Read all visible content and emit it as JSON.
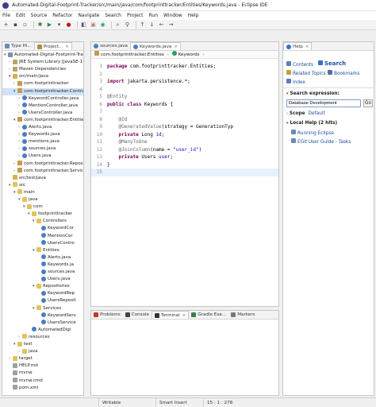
{
  "window": {
    "title": "Automated-Digital-Footprint-Tracker/src/main/java/com/footprinttracker/Entities/Keywords.java - Eclipse IDE"
  },
  "menu": [
    "File",
    "Edit",
    "Source",
    "Refactor",
    "Navigate",
    "Search",
    "Project",
    "Run",
    "Window",
    "Help"
  ],
  "left_panel": {
    "tabs": [
      {
        "label": "Type Hi..."
      },
      {
        "label": "Project..."
      }
    ],
    "tree": [
      {
        "depth": 0,
        "arrow": "▾",
        "icon": "proj",
        "label": "Automated-Digital-Footprint-Tracker"
      },
      {
        "depth": 1,
        "arrow": "›",
        "icon": "lib",
        "label": "JRE System Library [JavaSE-17]"
      },
      {
        "depth": 1,
        "arrow": "›",
        "icon": "lib",
        "label": "Maven Dependencies"
      },
      {
        "depth": 1,
        "arrow": "▾",
        "icon": "srcf",
        "label": "src/main/java"
      },
      {
        "depth": 2,
        "arrow": "›",
        "icon": "pkg",
        "label": "com.footprinttracker"
      },
      {
        "depth": 2,
        "arrow": "▾",
        "icon": "pkg",
        "label": "com.footprinttracker.Controllers",
        "selected": true
      },
      {
        "depth": 3,
        "arrow": "›",
        "icon": "java",
        "label": "KeywordController.java"
      },
      {
        "depth": 3,
        "arrow": "›",
        "icon": "java",
        "label": "MentionController.java"
      },
      {
        "depth": 3,
        "arrow": "›",
        "icon": "java",
        "label": "UsersController.java"
      },
      {
        "depth": 2,
        "arrow": "▾",
        "icon": "pkg",
        "label": "com.footprinttracker.Entities"
      },
      {
        "depth": 3,
        "arrow": "›",
        "icon": "java",
        "label": "Alerts.java"
      },
      {
        "depth": 3,
        "arrow": "›",
        "icon": "java",
        "label": "Keywords.java"
      },
      {
        "depth": 3,
        "arrow": "›",
        "icon": "java",
        "label": "mentions.java"
      },
      {
        "depth": 3,
        "arrow": "›",
        "icon": "java",
        "label": "sources.java"
      },
      {
        "depth": 3,
        "arrow": "›",
        "icon": "java",
        "label": "Users.java"
      },
      {
        "depth": 2,
        "arrow": "›",
        "icon": "pkg",
        "label": "com.footprinttracker.Repos"
      },
      {
        "depth": 2,
        "arrow": "›",
        "icon": "pkg",
        "label": "com.footprinttracker.Servic"
      },
      {
        "depth": 1,
        "arrow": "",
        "icon": "srcf",
        "label": "src/test/java"
      },
      {
        "depth": 1,
        "arrow": "▾",
        "icon": "folder",
        "label": "src"
      },
      {
        "depth": 2,
        "arrow": "▾",
        "icon": "folder",
        "label": "main"
      },
      {
        "depth": 3,
        "arrow": "▾",
        "icon": "folder",
        "label": "java"
      },
      {
        "depth": 4,
        "arrow": "▾",
        "icon": "folder",
        "label": "com"
      },
      {
        "depth": 5,
        "arrow": "▾",
        "icon": "folder",
        "label": "footprinttracker"
      },
      {
        "depth": 6,
        "arrow": "▾",
        "icon": "folder",
        "label": "Controllers"
      },
      {
        "depth": 7,
        "arrow": "",
        "icon": "java",
        "label": "KeywordCor"
      },
      {
        "depth": 7,
        "arrow": "",
        "icon": "java",
        "label": "MentionCor"
      },
      {
        "depth": 7,
        "arrow": "",
        "icon": "java",
        "label": "UsersContro"
      },
      {
        "depth": 6,
        "arrow": "▾",
        "icon": "folder",
        "label": "Entities"
      },
      {
        "depth": 7,
        "arrow": "",
        "icon": "java",
        "label": "Alerts.java"
      },
      {
        "depth": 7,
        "arrow": "",
        "icon": "java",
        "label": "Keywords.ja"
      },
      {
        "depth": 7,
        "arrow": "",
        "icon": "java",
        "label": "sources.java"
      },
      {
        "depth": 7,
        "arrow": "",
        "icon": "java",
        "label": "Users.java"
      },
      {
        "depth": 6,
        "arrow": "▾",
        "icon": "folder",
        "label": "Repositories"
      },
      {
        "depth": 7,
        "arrow": "",
        "icon": "java",
        "label": "KeywordRep"
      },
      {
        "depth": 7,
        "arrow": "",
        "icon": "java",
        "label": "UsersReposit"
      },
      {
        "depth": 6,
        "arrow": "▾",
        "icon": "folder",
        "label": "Services"
      },
      {
        "depth": 7,
        "arrow": "",
        "icon": "java",
        "label": "KeywordServ"
      },
      {
        "depth": 7,
        "arrow": "",
        "icon": "java",
        "label": "UsersService"
      },
      {
        "depth": 5,
        "arrow": "",
        "icon": "java",
        "label": "AutomatedDigi"
      },
      {
        "depth": 3,
        "arrow": "›",
        "icon": "folder",
        "label": "resources"
      },
      {
        "depth": 2,
        "arrow": "▾",
        "icon": "folder",
        "label": "test"
      },
      {
        "depth": 3,
        "arrow": "›",
        "icon": "folder",
        "label": "java"
      },
      {
        "depth": 1,
        "arrow": "›",
        "icon": "folder",
        "label": "target"
      },
      {
        "depth": 1,
        "arrow": "",
        "icon": "file",
        "label": "HELP.md"
      },
      {
        "depth": 1,
        "arrow": "",
        "icon": "file",
        "label": "mvnw"
      },
      {
        "depth": 1,
        "arrow": "",
        "icon": "file",
        "label": "mvnw.cmd"
      },
      {
        "depth": 1,
        "arrow": "",
        "icon": "file",
        "label": "pom.xml"
      }
    ]
  },
  "editor": {
    "tabs": [
      {
        "label": "sources.java",
        "active": false
      },
      {
        "label": "Keywords.java",
        "active": true
      }
    ],
    "breadcrumb": [
      "com.footprinttracker.Entities",
      "Keywords"
    ],
    "lines": [
      {
        "num": "1",
        "html": "<span class=\"kw\">package</span> com.footprinttracker.Entities;"
      },
      {
        "num": "2",
        "html": ""
      },
      {
        "num": "3",
        "html": "<span class=\"kw\">import</span> jakarta.persistence.*;"
      },
      {
        "num": "4",
        "html": ""
      },
      {
        "num": "5",
        "html": "<span class=\"ann\">@Entity</span>"
      },
      {
        "num": "6",
        "html": "<span class=\"kw\">public class</span> Keywords {"
      },
      {
        "num": "7",
        "html": ""
      },
      {
        "num": "8",
        "html": "    <span class=\"ann\">@Id</span>"
      },
      {
        "num": "9",
        "html": "    <span class=\"ann\">@GeneratedValue</span>(strategy = GenerationTyp"
      },
      {
        "num": "10",
        "html": "    <span class=\"kw\">private</span> Long <span class=\"fld\">id</span>;"
      },
      {
        "num": "11",
        "html": "    <span class=\"ann\">@ManyToOne</span>"
      },
      {
        "num": "12",
        "html": "    <span class=\"ann\">@JoinColumn</span>(name = <span class=\"str\">\"user_id\"</span>)"
      },
      {
        "num": "13",
        "html": "    <span class=\"kw\">private</span> Users <span class=\"fld\">user</span>;"
      },
      {
        "num": "14",
        "html": "}"
      },
      {
        "num": "15",
        "html": ""
      }
    ]
  },
  "bottom_panel": {
    "tabs": [
      {
        "label": "Problems"
      },
      {
        "label": "Console"
      },
      {
        "label": "Terminal",
        "active": true
      },
      {
        "label": "Gradle Exe..."
      },
      {
        "label": "Markers"
      }
    ]
  },
  "help_panel": {
    "tab": "Help",
    "links": {
      "contents": "Contents",
      "search": "Search",
      "related": "Related Topics",
      "bookmarks": "Bookmarks",
      "index": "Index"
    },
    "search_label": "Search expression:",
    "search_value": "Database Development",
    "go": "Go",
    "scope_label": "Scope",
    "scope_value": "Default",
    "local_help": "Local Help (2 hits)",
    "hits": [
      "Running Eclipse",
      "EGit User Guide - Tasks"
    ]
  },
  "status": {
    "writable": "Writable",
    "insert": "Smart Insert",
    "position": "15 : 1 : 278"
  }
}
